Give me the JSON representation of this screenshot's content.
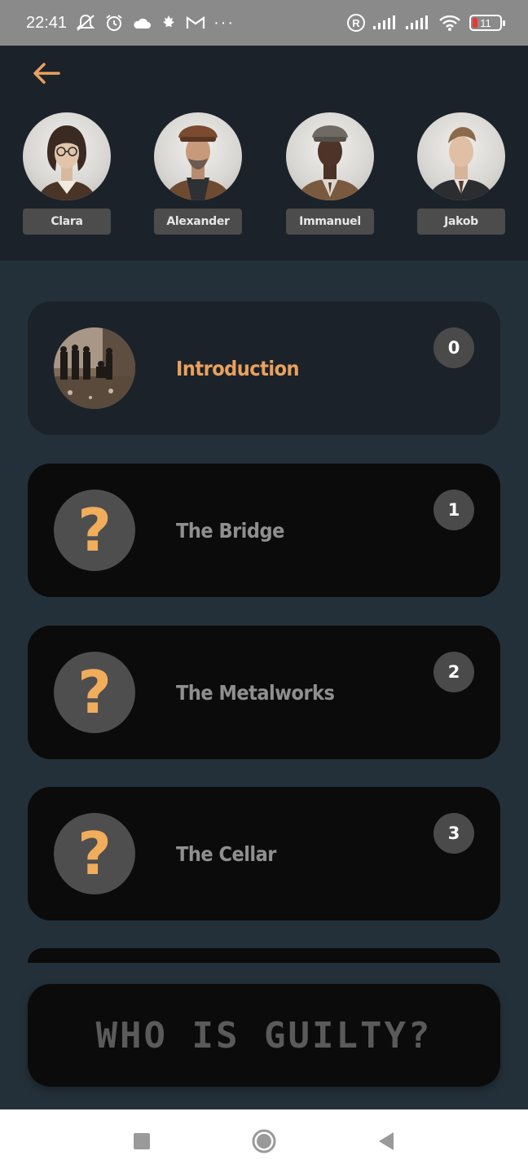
{
  "status_bar": {
    "time": "22:41",
    "battery_level": "11",
    "icons": [
      "notifications-off-icon",
      "alarm-icon",
      "cloud-icon",
      "maple-leaf-icon",
      "gmail-icon",
      "more-icon",
      "registered-icon",
      "signal-icon",
      "signal-icon",
      "wifi-icon",
      "battery-icon"
    ],
    "more_label": "···",
    "registered_label": "R"
  },
  "header": {
    "back_icon": "arrow-left-icon",
    "suspects": [
      {
        "name": "Clara"
      },
      {
        "name": "Alexander"
      },
      {
        "name": "Immanuel"
      },
      {
        "name": "Jakob"
      }
    ]
  },
  "chapters": [
    {
      "number": "0",
      "title": "Introduction",
      "state": "unlocked"
    },
    {
      "number": "1",
      "title": "The Bridge",
      "state": "locked",
      "thumb": "?"
    },
    {
      "number": "2",
      "title": "The Metalworks",
      "state": "locked",
      "thumb": "?"
    },
    {
      "number": "3",
      "title": "The Cellar",
      "state": "locked",
      "thumb": "?"
    }
  ],
  "guilty_button": {
    "label": "WHO IS GUILTY?"
  },
  "nav_bar": {
    "icons": [
      "recents-square-icon",
      "home-circle-icon",
      "back-triangle-icon"
    ]
  },
  "colors": {
    "accent": "#e8a15e",
    "header_bg": "#1b222a",
    "page_bg": "#243039",
    "card_locked_bg": "#0b0b0b"
  }
}
